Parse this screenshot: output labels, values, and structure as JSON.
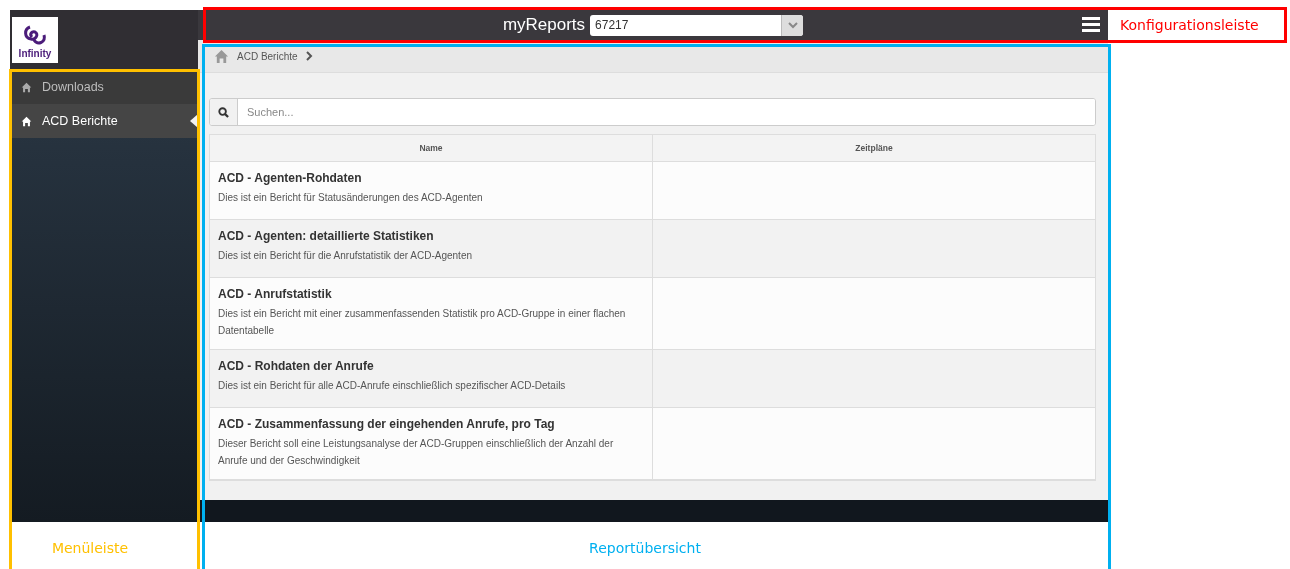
{
  "app": {
    "logo": {
      "text": "Infinity"
    },
    "title": "myReports",
    "selector": {
      "value": "67217"
    },
    "menu": [
      {
        "label": "Downloads",
        "selected": false
      },
      {
        "label": "ACD Berichte",
        "selected": true
      }
    ],
    "breadcrumb": [
      "ACD Berichte"
    ],
    "search": {
      "placeholder": "Suchen..."
    },
    "table": {
      "columns": [
        "Name",
        "Zeitpläne"
      ],
      "rows": [
        {
          "title": "ACD - Agenten-Rohdaten",
          "description": "Dies ist ein Bericht für Statusänderungen des ACD-Agenten"
        },
        {
          "title": "ACD - Agenten: detaillierte Statistiken",
          "description": "Dies ist ein Bericht für die Anrufstatistik der ACD-Agenten"
        },
        {
          "title": "ACD - Anrufstatistik",
          "description": "Dies ist ein Bericht mit einer zusammenfassenden Statistik pro ACD-Gruppe in einer flachen Datentabelle"
        },
        {
          "title": "ACD - Rohdaten der Anrufe",
          "description": "Dies ist ein Bericht für alle ACD-Anrufe einschließlich spezifischer ACD-Details"
        },
        {
          "title": "ACD - Zusammenfassung der eingehenden Anrufe, pro Tag",
          "description": "Dieser Bericht soll eine Leistungsanalyse der ACD-Gruppen einschließlich der Anzahl der Anrufe und der Geschwindigkeit"
        }
      ]
    }
  },
  "annotations": [
    {
      "kind": "config",
      "label": "Konfigurationsleiste",
      "color": "#ff0000"
    },
    {
      "kind": "menu",
      "label": "Menüleiste",
      "color": "#ffc000"
    },
    {
      "kind": "overview",
      "label": "Reportübersicht",
      "color": "#00b0f0"
    }
  ]
}
